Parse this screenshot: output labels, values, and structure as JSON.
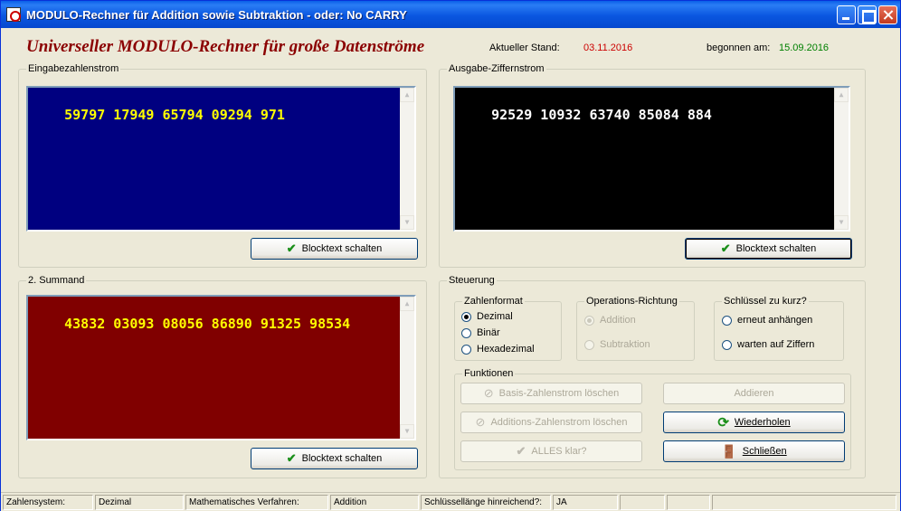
{
  "window": {
    "title": "MODULO-Rechner für Addition sowie Subtraktion - oder: No CARRY"
  },
  "header": {
    "app_title": "Universeller MODULO-Rechner für große Datenströme",
    "stand_label": "Aktueller Stand:",
    "stand_date": "03.11.2016",
    "begonnen_label": "begonnen am:",
    "begonnen_date": "15.09.2016",
    "colors": {
      "stand_date": "#cc0000",
      "begonnen_date": "#008000",
      "title": "#8b0000"
    }
  },
  "input_panel": {
    "legend": "Eingabezahlenstrom",
    "text": "59797 17949 65794 09294 971",
    "button": "Blocktext schalten",
    "colors": {
      "bg": "#000080",
      "fg": "#ffff00"
    }
  },
  "output_panel": {
    "legend": "Ausgabe-Ziffernstrom",
    "text": "92529 10932 63740 85084 884",
    "button": "Blocktext schalten",
    "colors": {
      "bg": "#000000",
      "fg": "#ffffff"
    }
  },
  "summand_panel": {
    "legend": "2. Summand",
    "text": "43832 03093 08056 86890 91325 98534",
    "button": "Blocktext schalten",
    "colors": {
      "bg": "#800000",
      "fg": "#ffff00"
    }
  },
  "control": {
    "legend": "Steuerung",
    "zahlenformat": {
      "legend": "Zahlenformat",
      "options": [
        "Dezimal",
        "Binär",
        "Hexadezimal"
      ],
      "selected": "Dezimal"
    },
    "richtung": {
      "legend": "Operations-Richtung",
      "options": [
        "Addition",
        "Subtraktion"
      ],
      "selected": "Addition"
    },
    "schluessel": {
      "legend": "Schlüssel zu kurz?",
      "options": [
        "erneut anhängen",
        "warten auf Ziffern"
      ]
    },
    "funktionen": {
      "legend": "Funktionen",
      "basis_loeschen": "Basis-Zahlenstrom löschen",
      "addieren": "Addieren",
      "additions_loeschen": "Additions-Zahlenstrom löschen",
      "wiederholen": "Wiederholen",
      "alles_klar": "ALLES klar?",
      "schliessen": "Schließen"
    }
  },
  "statusbar": {
    "zahlensystem_label": "Zahlensystem:",
    "zahlensystem_value": "Dezimal",
    "verfahren_label": "Mathematisches Verfahren:",
    "verfahren_value": "Addition",
    "schluessel_label": "Schlüssellänge hinreichend?:",
    "schluessel_value": "JA"
  }
}
